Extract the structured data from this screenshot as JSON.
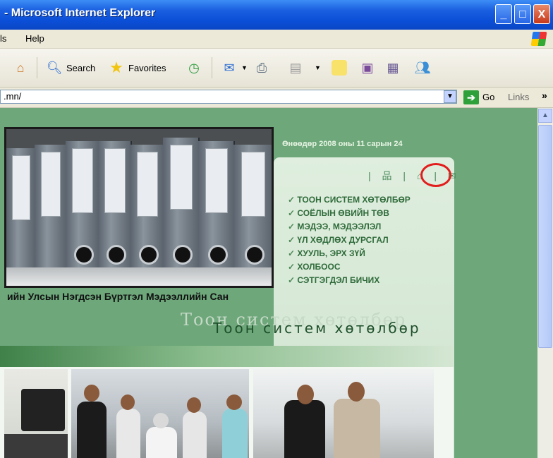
{
  "window": {
    "title": "- Microsoft Internet Explorer",
    "min": "_",
    "max": "□",
    "close": "X"
  },
  "menu": {
    "items": [
      "ls",
      "Help"
    ]
  },
  "toolbar": {
    "search_label": "Search",
    "favorites_label": "Favorites"
  },
  "address": {
    "value": ".mn/",
    "go_label": "Go",
    "links_label": "Links",
    "chevron": "»"
  },
  "page": {
    "date": "Өнөөдөр 2008 оны 11 сарын 24",
    "menu_items": [
      "ТООН СИСТЕМ ХӨТӨЛБӨР",
      "СОЁЛЫН ӨВИЙН ТӨВ",
      "МЭДЭЭ, МЭДЭЭЛЭЛ",
      "ҮЛ ХӨДЛӨХ ДУРСГАЛ",
      "ХУУЛЬ, ЭРХ ЗҮЙ",
      "ХОЛБООС",
      "СЭТГЭГДЭЛ БИЧИХ"
    ],
    "caption": "ийн Улсын Нэгдсэн Бүртгэл Мэдээллийн Сан",
    "faded": "Тоон систем хөтөлбөр",
    "headline": "Тоон систем хөтөлбөр"
  },
  "colors": {
    "content_bg": "#6da77a",
    "highlight_circle": "#e21d1d",
    "menu_text": "#2f6b3a"
  }
}
